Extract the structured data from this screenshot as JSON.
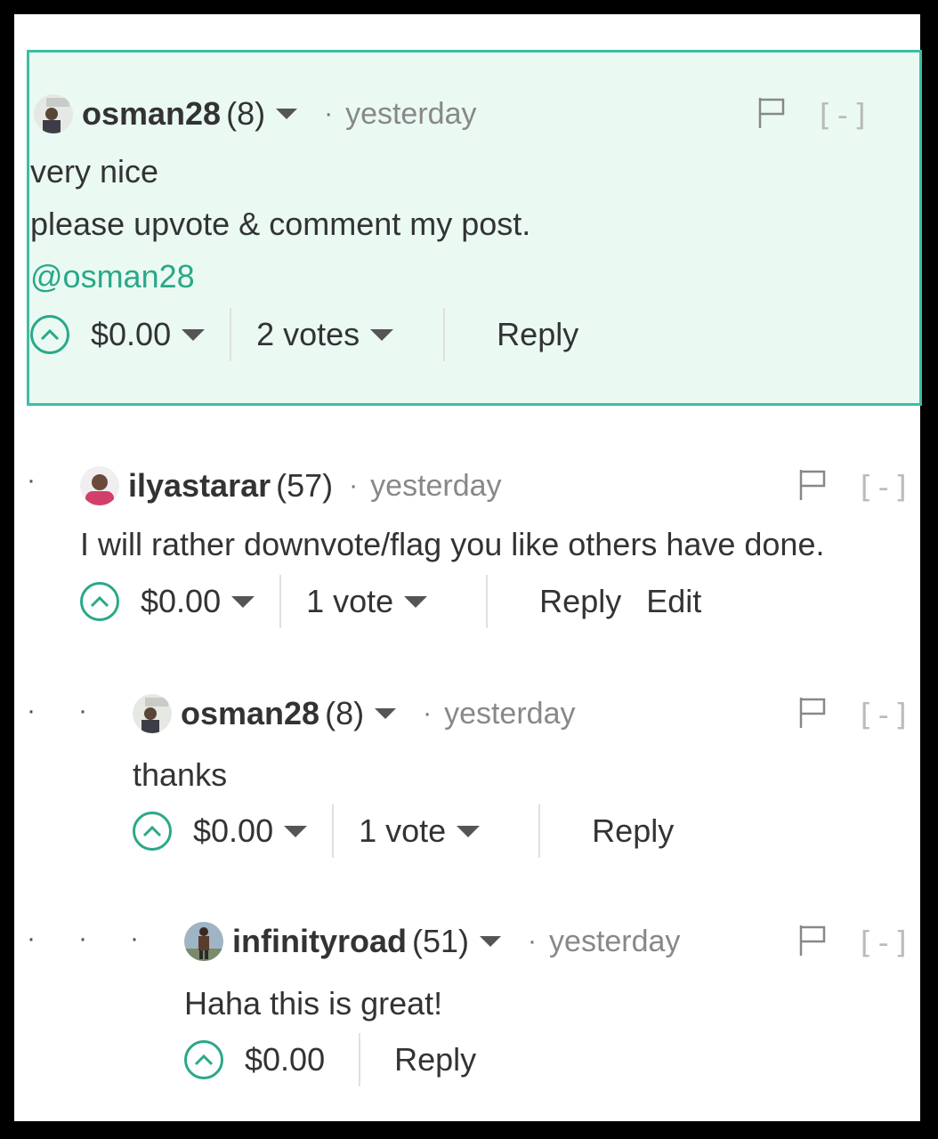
{
  "colors": {
    "accent": "#2aa888",
    "highlight_bg": "#eafaf3",
    "highlight_border": "#3bbfa5"
  },
  "comments": [
    {
      "author": "osman28",
      "reputation": "(8)",
      "time": "yesterday",
      "lines": [
        "very nice",
        "please upvote & comment my post."
      ],
      "mention": "@osman28",
      "payout": "$0.00",
      "votes": "2 votes",
      "reply": "Reply",
      "collapse": "[-]"
    },
    {
      "author": "ilyastarar",
      "reputation": "(57)",
      "time": "yesterday",
      "lines": [
        "I will rather downvote/flag you like others have done."
      ],
      "payout": "$0.00",
      "votes": "1 vote",
      "reply": "Reply",
      "edit": "Edit",
      "collapse": "[-]"
    },
    {
      "author": "osman28",
      "reputation": "(8)",
      "time": "yesterday",
      "lines": [
        "thanks"
      ],
      "payout": "$0.00",
      "votes": "1 vote",
      "reply": "Reply",
      "collapse": "[-]"
    },
    {
      "author": "infinityroad",
      "reputation": "(51)",
      "time": "yesterday",
      "lines": [
        "Haha this is great!"
      ],
      "payout": "$0.00",
      "reply": "Reply",
      "collapse": "[-]"
    }
  ],
  "icons": {
    "upvote": "chevron-up-icon",
    "flag": "flag-icon",
    "dropdown": "caret-down-icon"
  }
}
